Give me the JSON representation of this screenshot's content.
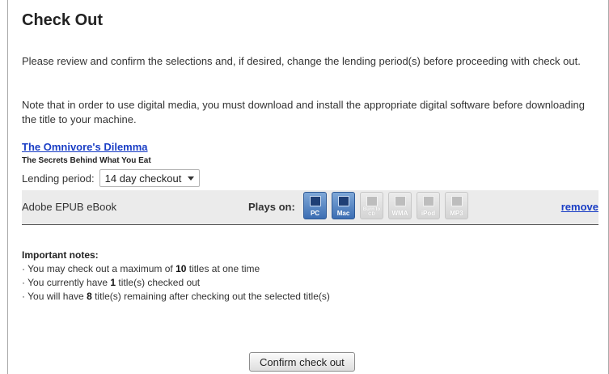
{
  "title": "Check Out",
  "intro": "Please review and confirm the selections and, if desired, change the lending period(s) before proceeding with check out.",
  "note": "Note that in order to use digital media, you must download and install the appropriate digital software before downloading the title to your machine.",
  "book": {
    "title": "The Omnivore's Dilemma",
    "subtitle": "The Secrets Behind What You Eat"
  },
  "lending": {
    "label": "Lending period:",
    "selected": "14 day checkout"
  },
  "format": {
    "name": "Adobe EPUB eBook",
    "plays_on_label": "Plays on:",
    "devices": [
      {
        "label": "PC",
        "active": true
      },
      {
        "label": "Mac",
        "active": true
      },
      {
        "label": "Burn to CD",
        "active": false
      },
      {
        "label": "WMA",
        "active": false
      },
      {
        "label": "iPod",
        "active": false
      },
      {
        "label": "MP3",
        "active": false
      }
    ],
    "remove_label": "remove"
  },
  "notes": {
    "heading": "Important notes:",
    "items": [
      {
        "pre": "· You may check out a maximum of ",
        "num": "10",
        "post": " titles at one time"
      },
      {
        "pre": "· You currently have ",
        "num": "1",
        "post": " title(s) checked out"
      },
      {
        "pre": "· You will have ",
        "num": "8",
        "post": " title(s) remaining after checking out the selected title(s)"
      }
    ]
  },
  "confirm_label": "Confirm check out"
}
